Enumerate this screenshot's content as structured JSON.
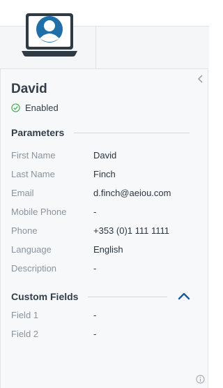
{
  "contact": {
    "name": "David",
    "status": "Enabled"
  },
  "parameters": {
    "heading": "Parameters",
    "fields": [
      {
        "label": "First Name",
        "value": "David"
      },
      {
        "label": "Last Name",
        "value": "Finch"
      },
      {
        "label": "Email",
        "value": "d.finch@aeiou.com"
      },
      {
        "label": "Mobile Phone",
        "value": "-"
      },
      {
        "label": "Phone",
        "value": "+353 (0)1 111 1111"
      },
      {
        "label": "Language",
        "value": "English"
      },
      {
        "label": "Description",
        "value": "-"
      }
    ]
  },
  "custom_fields": {
    "heading": "Custom Fields",
    "expanded": true,
    "fields": [
      {
        "label": "Field 1",
        "value": "-"
      },
      {
        "label": "Field 2",
        "value": "-"
      }
    ]
  },
  "icons": {
    "avatar": "laptop-user-icon",
    "status": "check-circle-icon",
    "collapse": "chevron-left-icon",
    "section_toggle": "chevron-up-icon",
    "info": "info-icon"
  },
  "colors": {
    "accent": "#1a5a96",
    "status_ok": "#4caf50"
  }
}
